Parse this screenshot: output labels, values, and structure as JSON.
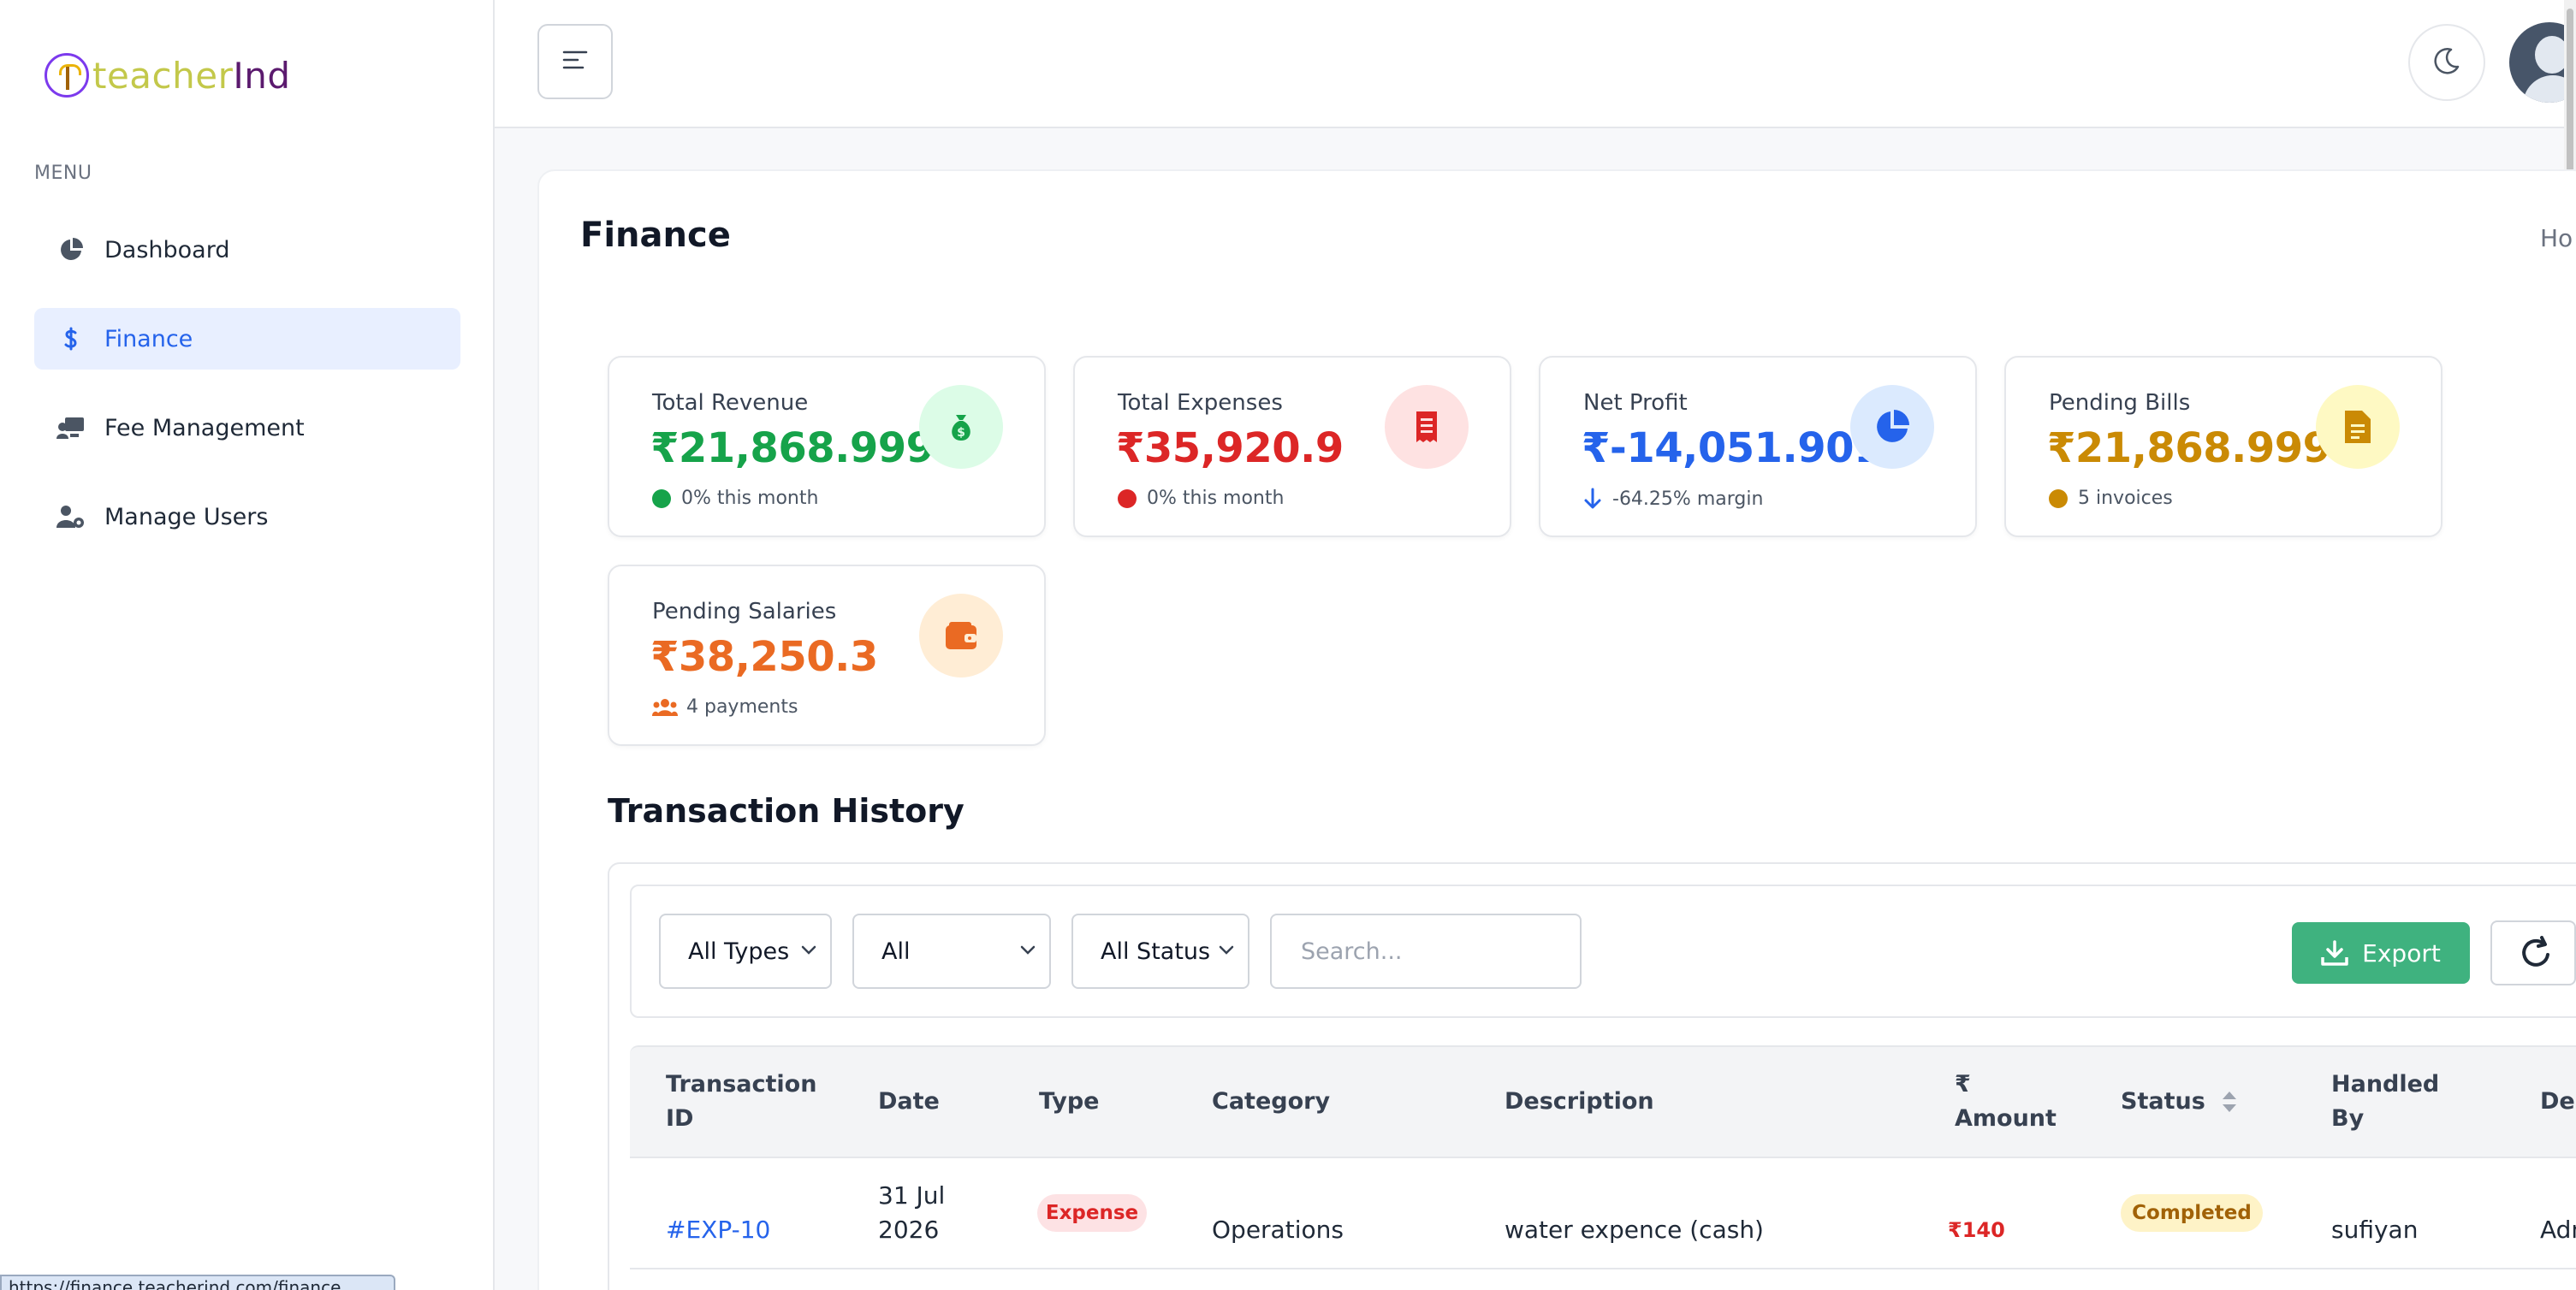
{
  "brand": {
    "logo_part1": "teacher",
    "logo_part2": "Ind"
  },
  "sidebar": {
    "menu_label": "MENU",
    "items": [
      {
        "label": "Dashboard",
        "icon": "pie-chart-icon",
        "active": false
      },
      {
        "label": "Finance",
        "icon": "dollar-icon",
        "active": true
      },
      {
        "label": "Fee Management",
        "icon": "chalkboard-user-icon",
        "active": false
      },
      {
        "label": "Manage Users",
        "icon": "users-gear-icon",
        "active": false
      }
    ]
  },
  "header": {
    "page_title": "Finance",
    "breadcrumb": "Ho"
  },
  "stats": [
    {
      "label": "Total Revenue",
      "value": "₹21,868.999",
      "sub": "0% this month",
      "color": "#16a34a",
      "icon_bg": "#dcfce7",
      "icon": "money-bag-icon"
    },
    {
      "label": "Total Expenses",
      "value": "₹35,920.9",
      "sub": "0% this month",
      "color": "#dc2626",
      "icon_bg": "#fee2e2",
      "icon": "receipt-icon"
    },
    {
      "label": "Net Profit",
      "value": "₹-14,051.901",
      "sub": "-64.25% margin",
      "color": "#2563eb",
      "icon_bg": "#dbeafe",
      "icon": "pie-chart-icon"
    },
    {
      "label": "Pending Bills",
      "value": "₹21,868.999",
      "sub": "5 invoices",
      "color": "#ca8a04",
      "icon_bg": "#fef9c3",
      "icon": "file-invoice-icon"
    },
    {
      "label": "Pending Salaries",
      "value": "₹38,250.3",
      "sub": "4 payments",
      "color": "#ea6a23",
      "icon_bg": "#ffedd5",
      "icon": "wallet-icon"
    }
  ],
  "transactions": {
    "title": "Transaction History",
    "filters": {
      "type": "All Types",
      "period": "All",
      "status": "All Status"
    },
    "search_placeholder": "Search...",
    "export_label": "Export",
    "columns": {
      "id_line1": "Transaction",
      "id_line2": "ID",
      "date": "Date",
      "type": "Type",
      "category": "Category",
      "description": "Description",
      "amount_line1": "₹",
      "amount_line2": "Amount",
      "status": "Status",
      "handled_line1": "Handled",
      "handled_line2": "By",
      "dept": "Dep"
    },
    "rows": [
      {
        "id": "#EXP-10",
        "date_line1": "31 Jul",
        "date_line2": "2026",
        "type": "Expense",
        "category": "Operations",
        "description": "water expence (cash)",
        "amount": "₹140",
        "status": "Completed",
        "handled_by": "sufiyan",
        "dept": "Adm"
      }
    ]
  },
  "status_url": "https://finance.teacherind.com/finance"
}
